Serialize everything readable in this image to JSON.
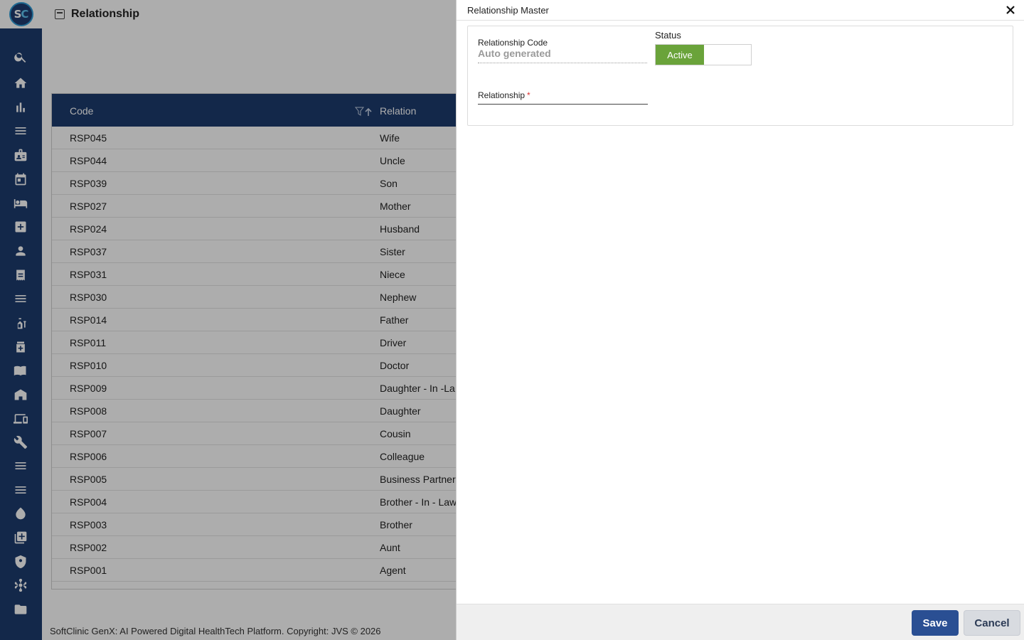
{
  "app": {
    "logo_text_a": "S",
    "logo_text_b": "C",
    "page_title": "Relationship",
    "footer": "SoftClinic GenX: AI Powered Digital HealthTech Platform. Copyright: JVS © 2026"
  },
  "sidebar": {
    "icons": [
      "search-icon",
      "home-icon",
      "bar-chart-icon",
      "menu-icon",
      "badge-icon",
      "calendar-icon",
      "bed-icon",
      "medical-plus-icon",
      "person-icon",
      "receipt-icon",
      "list-icon",
      "vaccine-icon",
      "medicine-box-icon",
      "book-icon",
      "building-icon",
      "devices-icon",
      "wrench-icon",
      "list-icon",
      "list-icon",
      "drop-icon",
      "add-box-icon",
      "shield-icon",
      "hub-icon",
      "folder-icon"
    ]
  },
  "grid": {
    "headers": {
      "code": "Code",
      "relation": "Relation"
    },
    "rows": [
      {
        "code": "RSP045",
        "relation": "Wife"
      },
      {
        "code": "RSP044",
        "relation": "Uncle"
      },
      {
        "code": "RSP039",
        "relation": "Son"
      },
      {
        "code": "RSP027",
        "relation": "Mother"
      },
      {
        "code": "RSP024",
        "relation": "Husband"
      },
      {
        "code": "RSP037",
        "relation": "Sister"
      },
      {
        "code": "RSP031",
        "relation": "Niece"
      },
      {
        "code": "RSP030",
        "relation": "Nephew"
      },
      {
        "code": "RSP014",
        "relation": "Father"
      },
      {
        "code": "RSP011",
        "relation": "Driver"
      },
      {
        "code": "RSP010",
        "relation": "Doctor"
      },
      {
        "code": "RSP009",
        "relation": "Daughter - In -La"
      },
      {
        "code": "RSP008",
        "relation": "Daughter"
      },
      {
        "code": "RSP007",
        "relation": "Cousin"
      },
      {
        "code": "RSP006",
        "relation": "Colleague"
      },
      {
        "code": "RSP005",
        "relation": "Business Partner"
      },
      {
        "code": "RSP004",
        "relation": "Brother - In - Law"
      },
      {
        "code": "RSP003",
        "relation": "Brother"
      },
      {
        "code": "RSP002",
        "relation": "Aunt"
      },
      {
        "code": "RSP001",
        "relation": "Agent"
      }
    ]
  },
  "panel": {
    "title": "Relationship Master",
    "code_label": "Relationship Code",
    "code_value": "Auto generated",
    "status_label": "Status",
    "status_value": "Active",
    "relationship_label": "Relationship",
    "required_mark": "*",
    "relationship_value": "",
    "save_label": "Save",
    "cancel_label": "Cancel"
  },
  "colors": {
    "sidebar": "#1c3b6e",
    "grid_header": "#1c3b6e",
    "status_active": "#6aa33a",
    "save_button": "#2a4f93"
  }
}
